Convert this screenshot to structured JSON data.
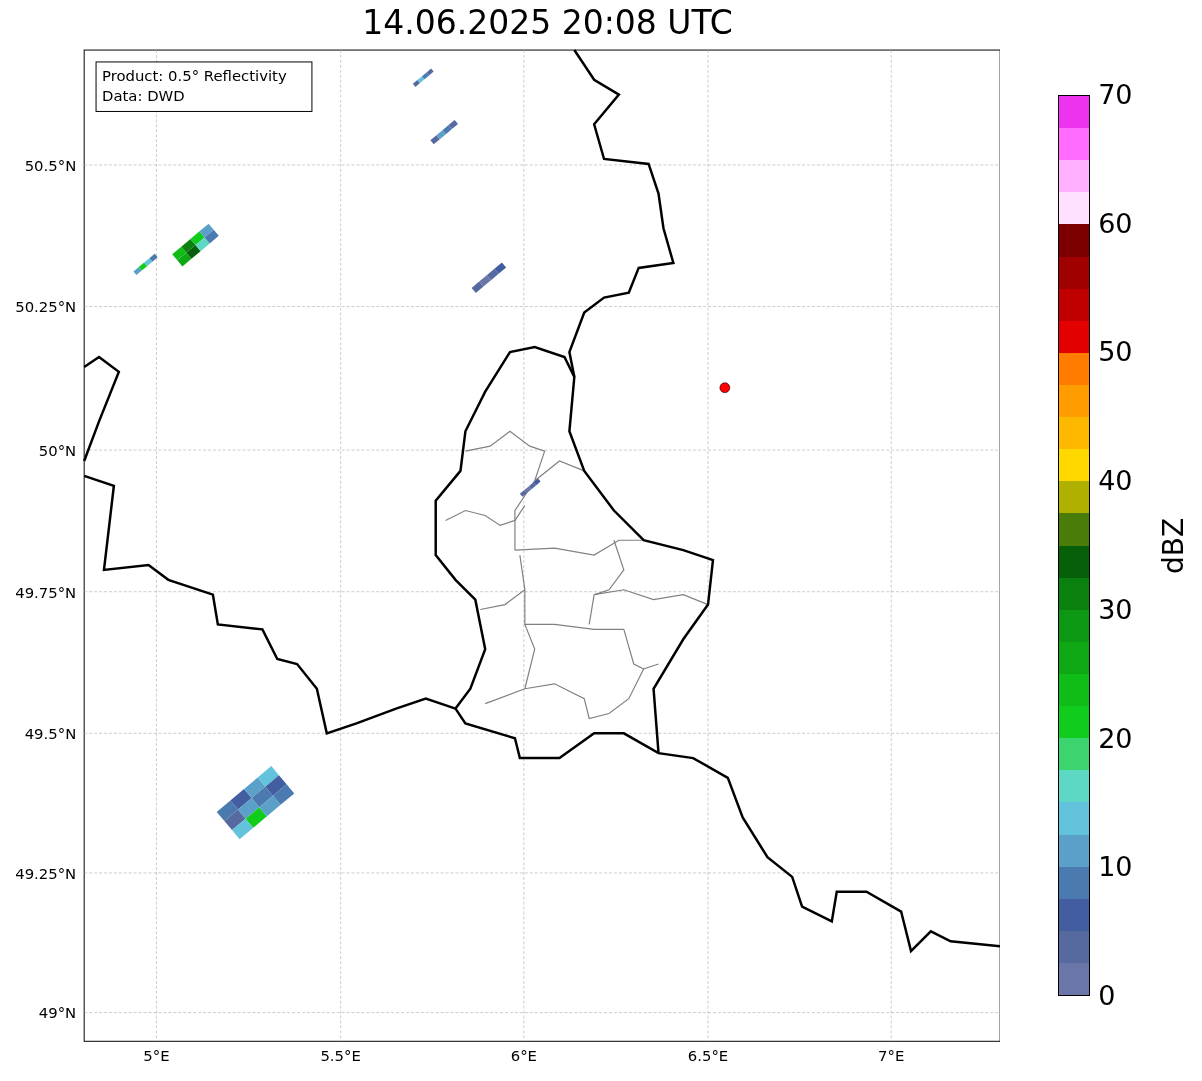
{
  "title": "14.06.2025 20:08 UTC",
  "info_box": [
    "Product: 0.5° Reflectivity",
    "Data: DWD"
  ],
  "map": {
    "lat_labels": [
      "50.5°N",
      "50.25°N",
      "50°N",
      "49.75°N",
      "49.5°N",
      "49.25°N",
      "49°N"
    ],
    "lon_labels": [
      "5°E",
      "5.5°E",
      "6°E",
      "6.5°E",
      "7°E"
    ]
  },
  "colorbar": {
    "label": "dBZ",
    "ticks": [
      "70",
      "60",
      "50",
      "40",
      "30",
      "20",
      "10",
      "0"
    ],
    "bins": [
      {
        "color": "#ee33ee"
      },
      {
        "color": "#ff6cff"
      },
      {
        "color": "#ffb0ff"
      },
      {
        "color": "#ffe0ff"
      },
      {
        "color": "#7c0000"
      },
      {
        "color": "#a00000"
      },
      {
        "color": "#c00000"
      },
      {
        "color": "#e20000"
      },
      {
        "color": "#ff7c00"
      },
      {
        "color": "#ff9c00"
      },
      {
        "color": "#ffb800"
      },
      {
        "color": "#ffd800"
      },
      {
        "color": "#b0b000"
      },
      {
        "color": "#4a7c0a"
      },
      {
        "color": "#075f0a"
      },
      {
        "color": "#0a800e"
      },
      {
        "color": "#0c9812"
      },
      {
        "color": "#0ea814"
      },
      {
        "color": "#10bc18"
      },
      {
        "color": "#10cc1c"
      },
      {
        "color": "#3cd46e"
      },
      {
        "color": "#5cd8c4"
      },
      {
        "color": "#64c3dc"
      },
      {
        "color": "#5aa0c8"
      },
      {
        "color": "#4a7ab0"
      },
      {
        "color": "#435ea0"
      },
      {
        "color": "#566aa0"
      },
      {
        "color": "#6a76a8"
      }
    ]
  }
}
